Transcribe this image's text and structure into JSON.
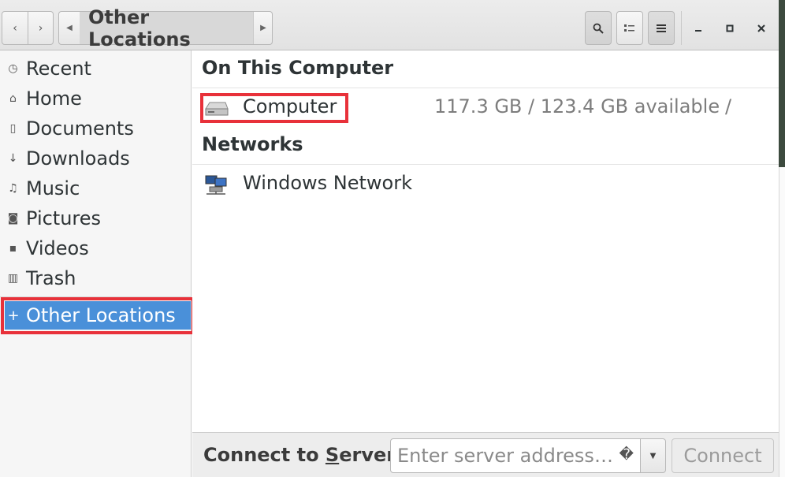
{
  "window": {
    "title": "Other Locations"
  },
  "header": {
    "path_crumb": "Other Locations",
    "icons": {
      "back": "chevron-left-icon",
      "forward": "chevron-right-icon",
      "search": "search-icon",
      "view": "view-options-icon",
      "menu": "hamburger-menu-icon",
      "minimize": "minimize-icon",
      "maximize": "maximize-icon",
      "close": "close-icon"
    }
  },
  "sidebar": {
    "items": [
      {
        "label": "Recent",
        "icon": "clock-icon"
      },
      {
        "label": "Home",
        "icon": "home-icon"
      },
      {
        "label": "Documents",
        "icon": "document-icon"
      },
      {
        "label": "Downloads",
        "icon": "download-icon"
      },
      {
        "label": "Music",
        "icon": "music-icon"
      },
      {
        "label": "Pictures",
        "icon": "camera-icon"
      },
      {
        "label": "Videos",
        "icon": "video-icon"
      },
      {
        "label": "Trash",
        "icon": "trash-icon"
      }
    ],
    "other_locations": {
      "label": "Other Locations",
      "icon": "plus-icon",
      "selected": true
    }
  },
  "main": {
    "on_this_computer": {
      "title": "On This Computer",
      "items": [
        {
          "label": "Computer",
          "info": "117.3 GB / 123.4 GB available",
          "path": "/",
          "icon": "drive-icon"
        }
      ]
    },
    "networks": {
      "title": "Networks",
      "items": [
        {
          "label": "Windows Network",
          "icon": "network-icon"
        }
      ]
    }
  },
  "connect": {
    "label_prefix": "Connect to ",
    "label_mnemonic": "S",
    "label_suffix": "erver",
    "placeholder": "Enter server address…",
    "hint_glyph": "�",
    "button": "Connect"
  },
  "colors": {
    "selection": "#4a90d9",
    "highlight_box": "#e8313a",
    "sidebar_bg": "#f6f6f6"
  }
}
